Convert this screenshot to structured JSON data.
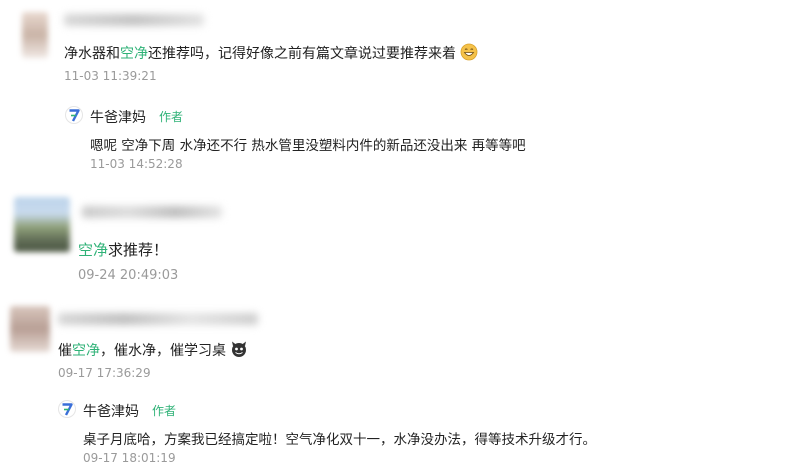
{
  "comments": [
    {
      "text_pre": "净水器和",
      "text_highlight": "空净",
      "text_post": "还推荐吗，记得好像之前有篇文章说过要推荐来着",
      "emoji": "grinning-face-emoji",
      "time": "11-03 11:39:21",
      "reply": {
        "author": "牛爸津妈",
        "tag": "作者",
        "text": "嗯呢 空净下周 水净还不行 热水管里没塑料内件的新品还没出来 再等等吧",
        "time": "11-03 14:52:28"
      }
    },
    {
      "text_highlight": "空净",
      "text_post": "求推荐！",
      "time": "09-24 20:49:03"
    },
    {
      "text_pre": "催",
      "text_highlight": "空净",
      "text_post": "，催水净，催学习桌",
      "emoji": "devil-face-emoji",
      "time": "09-17 17:36:29",
      "reply": {
        "author": "牛爸津妈",
        "tag": "作者",
        "text": "桌子月底哈，方案我已经搞定啦！空气净化双十一，水净没办法，得等技术升级才行。",
        "time": "09-17 18:01:19"
      }
    }
  ],
  "colors": {
    "highlight": "#2fb277",
    "timestamp": "#9a9a9a",
    "author_tag": "#2fb277"
  }
}
